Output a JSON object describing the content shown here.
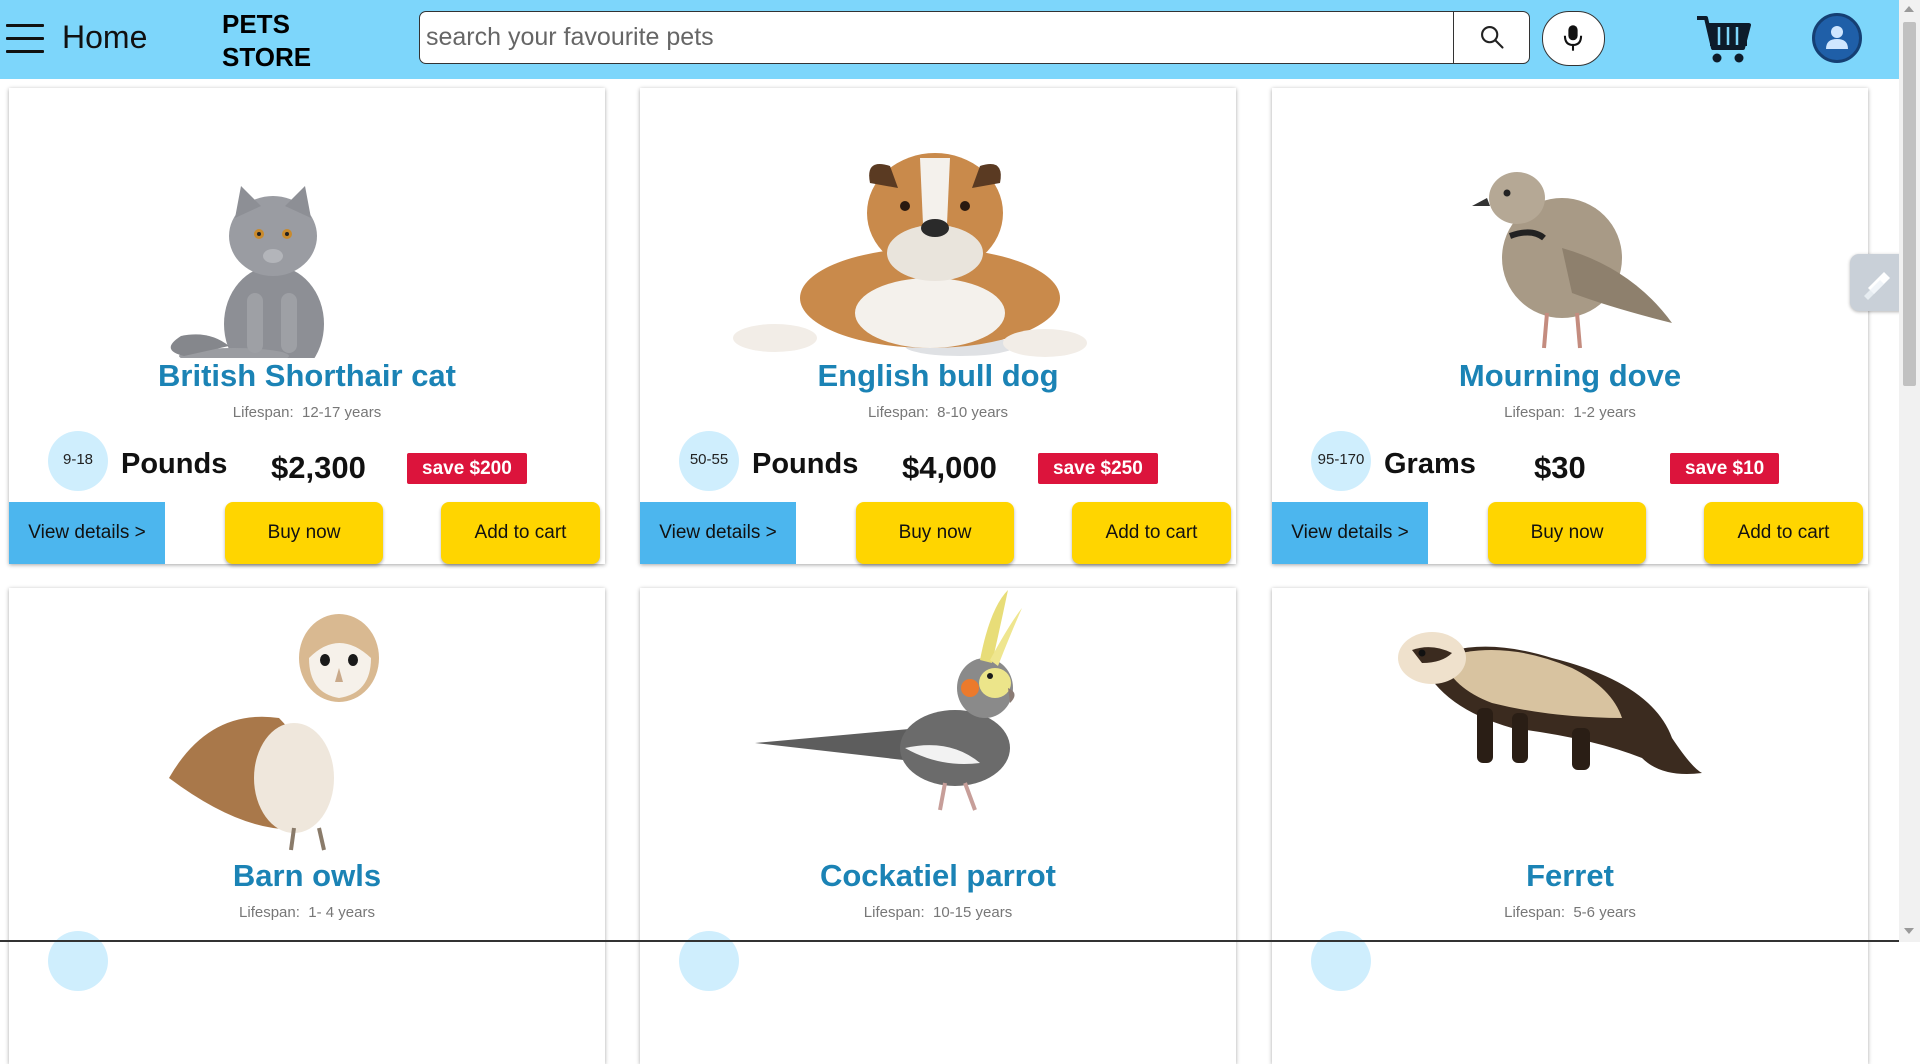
{
  "header": {
    "home_label": "Home",
    "brand_line1": "PETS",
    "brand_line2": "STORE",
    "search_placeholder": "search your favourite pets",
    "background_color": "#7dd6fb"
  },
  "card_labels": {
    "view_details": "View details >",
    "buy_now": "Buy now",
    "add_to_cart": "Add to cart"
  },
  "colors": {
    "title": "#1b83b5",
    "save_badge": "#dc143c",
    "view_button": "#4cb6ee",
    "action_button": "#ffd500",
    "weight_badge": "#cfeefd"
  },
  "pets": [
    {
      "name": "British Shorthair cat",
      "lifespan_label": "Lifespan:",
      "lifespan": "12-17 years",
      "weight_range": "9-18",
      "weight_unit": "Pounds",
      "price": "$2,300",
      "save": "save $200",
      "image": "grey-cat-photo"
    },
    {
      "name": "English bull dog",
      "lifespan_label": "Lifespan:",
      "lifespan": "8-10 years",
      "weight_range": "50-55",
      "weight_unit": "Pounds",
      "price": "$4,000",
      "save": "save $250",
      "image": "bulldog-photo"
    },
    {
      "name": "Mourning dove",
      "lifespan_label": "Lifespan:",
      "lifespan": "1-2 years",
      "weight_range": "95-170",
      "weight_unit": "Grams",
      "price": "$30",
      "save": "save $10",
      "image": "dove-photo"
    },
    {
      "name": "Barn owls",
      "lifespan_label": "Lifespan:",
      "lifespan": "1- 4 years",
      "image": "barn-owl-photo"
    },
    {
      "name": "Cockatiel parrot",
      "lifespan_label": "Lifespan:",
      "lifespan": "10-15 years",
      "image": "cockatiel-photo"
    },
    {
      "name": "Ferret",
      "lifespan_label": "Lifespan:",
      "lifespan": "5-6 years",
      "image": "ferret-photo"
    }
  ]
}
